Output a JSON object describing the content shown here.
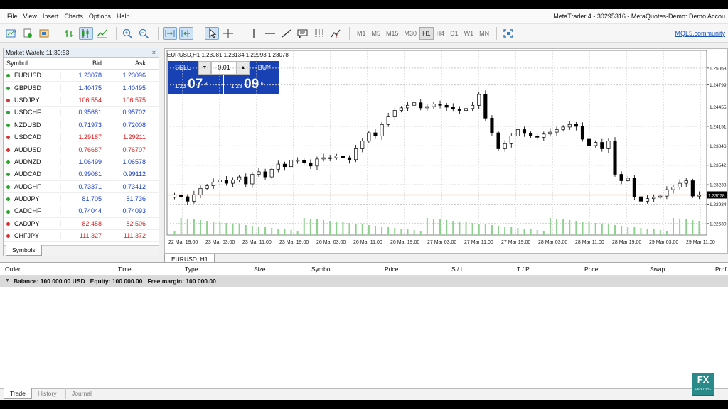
{
  "window": {
    "title": "MetaTrader 4 - 30295316 - MetaQuotes-Demo: Demo Accou"
  },
  "menu": [
    "File",
    "View",
    "Insert",
    "Charts",
    "Options",
    "Help"
  ],
  "toolbar": {
    "icons": [
      "new-chart-icon",
      "profiles-icon",
      "market-watch-icon",
      "navigator-icon",
      "bar-chart-icon",
      "candlestick-chart-icon",
      "line-chart-icon",
      "zoom-in-icon",
      "zoom-out-icon",
      "auto-scroll-icon",
      "chart-shift-icon",
      "cursor-icon",
      "crosshair-icon",
      "vertical-line-icon",
      "horizontal-line-icon",
      "trendline-icon",
      "text-label-icon",
      "fibonacci-icon",
      "indicators-icon",
      "fullscreen-icon"
    ],
    "periods": [
      "M1",
      "M5",
      "M15",
      "M30",
      "H1",
      "H4",
      "D1",
      "W1",
      "MN"
    ],
    "active_period": "H1",
    "mql5_link": "MQL5.community"
  },
  "market_watch": {
    "title": "Market Watch: 11:39:53",
    "close": "×",
    "columns": [
      "Symbol",
      "Bid",
      "Ask"
    ],
    "rows": [
      {
        "symbol": "EURUSD",
        "bid": "1.23078",
        "ask": "1.23096",
        "dir": "up"
      },
      {
        "symbol": "GBPUSD",
        "bid": "1.40475",
        "ask": "1.40495",
        "dir": "up"
      },
      {
        "symbol": "USDJPY",
        "bid": "106.554",
        "ask": "106.575",
        "dir": "down"
      },
      {
        "symbol": "USDCHF",
        "bid": "0.95681",
        "ask": "0.95702",
        "dir": "up"
      },
      {
        "symbol": "NZDUSD",
        "bid": "0.71973",
        "ask": "0.72008",
        "dir": "up"
      },
      {
        "symbol": "USDCAD",
        "bid": "1.29187",
        "ask": "1.29211",
        "dir": "down"
      },
      {
        "symbol": "AUDUSD",
        "bid": "0.76687",
        "ask": "0.76707",
        "dir": "down"
      },
      {
        "symbol": "AUDNZD",
        "bid": "1.06499",
        "ask": "1.06578",
        "dir": "up"
      },
      {
        "symbol": "AUDCAD",
        "bid": "0.99061",
        "ask": "0.99112",
        "dir": "up"
      },
      {
        "symbol": "AUDCHF",
        "bid": "0.73371",
        "ask": "0.73412",
        "dir": "up"
      },
      {
        "symbol": "AUDJPY",
        "bid": "81.705",
        "ask": "81.736",
        "dir": "up"
      },
      {
        "symbol": "CADCHF",
        "bid": "0.74044",
        "ask": "0.74093",
        "dir": "up"
      },
      {
        "symbol": "CADJPY",
        "bid": "82.458",
        "ask": "82.506",
        "dir": "down"
      },
      {
        "symbol": "CHFJPY",
        "bid": "111.327",
        "ask": "111.372",
        "dir": "down"
      }
    ],
    "tab": "Symbols"
  },
  "chart": {
    "info": "EURUSD,H1  1.23081 1.23134 1.22993 1.23078",
    "tab_label": "EURUSD, H1",
    "one_click": {
      "sell_label": "SELL",
      "buy_label": "BUY",
      "lot": "0.01",
      "sell_price": {
        "prefix": "1.23",
        "big": "07",
        "sup": "8"
      },
      "buy_price": {
        "prefix": "1.23",
        "big": "09",
        "sup": "6"
      }
    },
    "current_price": "1.23078"
  },
  "chart_data": {
    "type": "candlestick",
    "symbol": "EURUSD",
    "timeframe": "H1",
    "y_ticks": [
      "1.25063",
      "1.24799",
      "1.24455",
      "1.24151",
      "1.23846",
      "1.23542",
      "1.23238",
      "1.22934",
      "1.22630"
    ],
    "x_ticks": [
      "22 Mar 19:00",
      "23 Mar 03:00",
      "23 Mar 11:00",
      "23 Mar 19:00",
      "26 Mar 03:00",
      "26 Mar 11:00",
      "26 Mar 19:00",
      "27 Mar 03:00",
      "27 Mar 11:00",
      "27 Mar 19:00",
      "28 Mar 03:00",
      "28 Mar 11:00",
      "28 Mar 19:00",
      "29 Mar 03:00",
      "29 Mar 11:00"
    ],
    "ylim": [
      1.2245,
      1.2525
    ],
    "close": [
      1.2308,
      1.2305,
      1.2298,
      1.2308,
      1.2318,
      1.2322,
      1.2328,
      1.2331,
      1.2326,
      1.2331,
      1.2336,
      1.2325,
      1.234,
      1.2344,
      1.2336,
      1.2348,
      1.2356,
      1.2352,
      1.2362,
      1.2362,
      1.2358,
      1.2353,
      1.2364,
      1.2366,
      1.2366,
      1.2369,
      1.2366,
      1.2363,
      1.238,
      1.2392,
      1.2405,
      1.24,
      1.2418,
      1.243,
      1.244,
      1.2444,
      1.2448,
      1.2452,
      1.2444,
      1.2446,
      1.245,
      1.2448,
      1.2445,
      1.2442,
      1.244,
      1.2443,
      1.2448,
      1.2465,
      1.2428,
      1.2405,
      1.238,
      1.2388,
      1.24,
      1.241,
      1.2404,
      1.24,
      1.2398,
      1.2403,
      1.2406,
      1.241,
      1.2414,
      1.2418,
      1.2415,
      1.2395,
      1.2385,
      1.239,
      1.238,
      1.2392,
      1.234,
      1.233,
      1.2334,
      1.2305,
      1.2298,
      1.2302,
      1.2304,
      1.2306,
      1.2316,
      1.232,
      1.2326,
      1.233,
      1.2306,
      1.2308
    ],
    "volume_bars": true,
    "grid": true
  },
  "terminal": {
    "columns": [
      "Order",
      "Time",
      "Type",
      "Size",
      "Symbol",
      "Price",
      "S / L",
      "T / P",
      "Price",
      "Swap",
      "Profit"
    ],
    "balance_line": "Balance: 100 000.00 USD   Equity: 100 000.00   Free margin: 100 000.00",
    "tabs": [
      "Trade",
      "History",
      "Journal"
    ],
    "active_tab": "Trade"
  },
  "badge": {
    "line1": "FX",
    "line2": "CENTRAL"
  },
  "colors": {
    "bull": "#ffffff",
    "bear": "#000000",
    "price_line": "#e89a70",
    "volume": "#8ed18e",
    "buy_up": "#1a3fd0",
    "sell_down": "#e02020",
    "one_click_blue": "#1841b3",
    "selected_tool": "#cfe3f6"
  }
}
